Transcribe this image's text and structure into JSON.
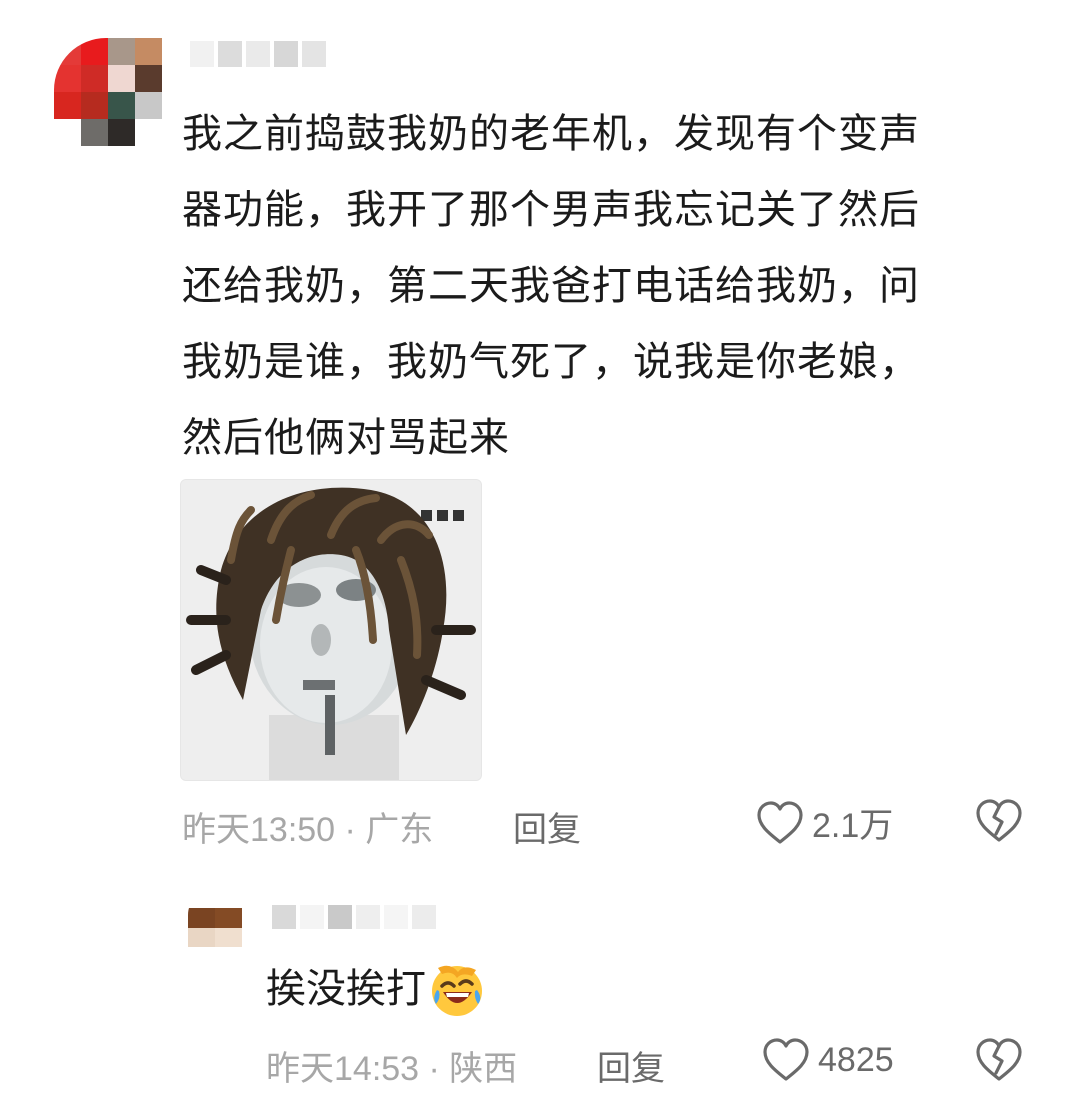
{
  "comment": {
    "text": "我之前捣鼓我奶的老年机，发现有个变声\n器功能，我开了那个男声我忘记关了然后\n还给我奶，第二天我爸打电话给我奶，问\n我奶是谁，我奶气死了，说我是你老娘，\n然后他俩对骂起来",
    "time_location": "昨天13:50 · 广东",
    "reply_label": "回复",
    "like_count": "2.1万",
    "icons": {
      "like": "heart-outline-icon",
      "dislike": "broken-heart-icon"
    }
  },
  "reply": {
    "text": "挨没挨打",
    "emoji": "rolling-laughing-emoji",
    "time_location": "昨天14:53 · 陕西",
    "reply_label": "回复",
    "like_count": "4825"
  },
  "colors": {
    "text": "#1b1b1b",
    "meta": "#a7a7a7",
    "action": "#6a6a6a",
    "background": "#ffffff"
  }
}
